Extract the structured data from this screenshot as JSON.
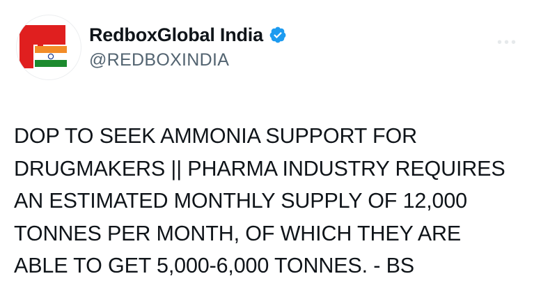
{
  "account": {
    "display_name": "RedboxGlobal India",
    "handle": "@REDBOXINDIA",
    "avatar_icon": "redbox-india-logo-icon",
    "verified_icon": "verified-badge-icon"
  },
  "post": {
    "text": "DOP TO SEEK AMMONIA SUPPORT FOR\nDRUGMAKERS || PHARMA INDUSTRY REQUIRES\nAN ESTIMATED MONTHLY SUPPLY OF 12,000\nTONNES PER MONTH, OF WHICH THEY ARE\nABLE TO GET 5,000-6,000 TONNES. - BS"
  },
  "colors": {
    "brand_red": "#e01f1f",
    "saffron": "#f28c28",
    "green": "#1c8a2e",
    "verified_blue": "#1d9bf0",
    "handle_gray": "#536471"
  }
}
